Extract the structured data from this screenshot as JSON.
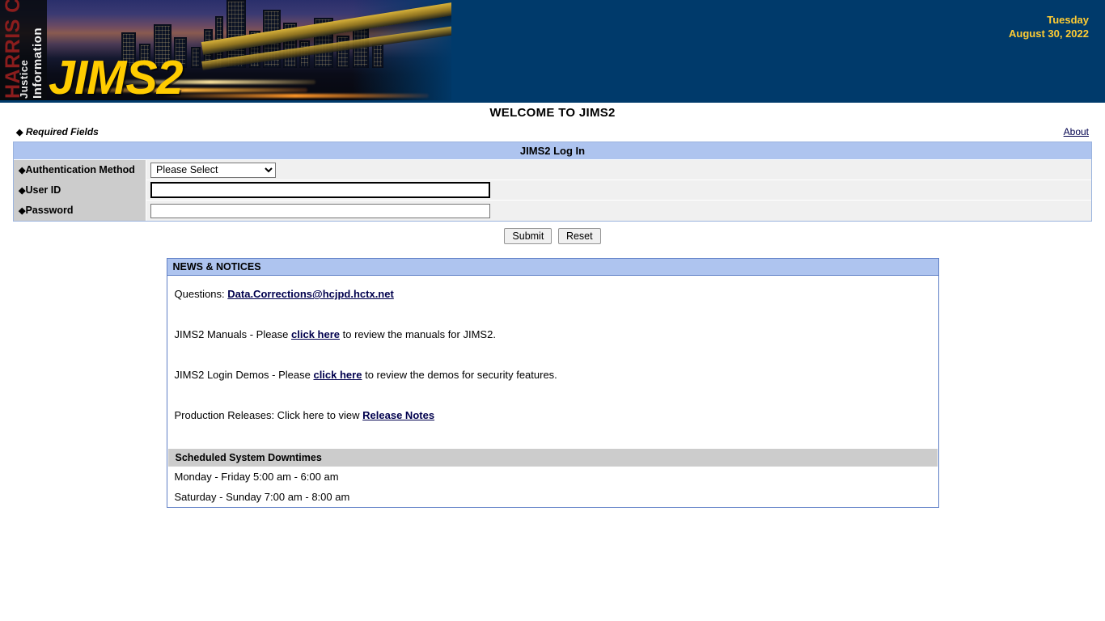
{
  "banner": {
    "logo_text": "JIMS2",
    "vertical_harris": "HARRIS CO",
    "vertical_justice": "Justice",
    "vertical_information": "Information",
    "day": "Tuesday",
    "date": "August 30, 2022",
    "colors": {
      "navy": "#003a6b",
      "gold": "#ffcc00",
      "date_gold": "#ffcc33"
    }
  },
  "page": {
    "welcome_title": "WELCOME TO JIMS2",
    "required_fields_label": "Required Fields",
    "diamond_glyph": "◆",
    "about_label": "About"
  },
  "login": {
    "panel_title": "JIMS2 Log In",
    "rows": [
      {
        "label": "Authentication Method",
        "type": "select"
      },
      {
        "label": "User ID",
        "type": "text"
      },
      {
        "label": "Password",
        "type": "password"
      }
    ],
    "auth_method": {
      "selected": "Please Select",
      "options": [
        "Please Select"
      ]
    },
    "user_id_value": "",
    "user_id_placeholder": "",
    "password_value": "",
    "password_placeholder": "",
    "submit_label": "Submit",
    "reset_label": "Reset"
  },
  "news": {
    "title": "NEWS & NOTICES",
    "questions_prefix": "Questions: ",
    "questions_email": "Data.Corrections@hcjpd.hctx.net",
    "manuals_prefix": "JIMS2 Manuals - Please ",
    "manuals_link": "click here",
    "manuals_suffix": " to review the manuals for JIMS2.",
    "demos_prefix": "JIMS2 Login Demos - Please ",
    "demos_link": "click here",
    "demos_suffix": " to review the demos for security features.",
    "releases_prefix": "Production Releases: Click here to view ",
    "releases_link": "Release Notes",
    "downtime_header": "Scheduled System Downtimes",
    "downtime_lines": [
      "Monday - Friday 5:00 am - 6:00 am",
      "Saturday - Sunday 7:00 am - 8:00 am"
    ]
  }
}
